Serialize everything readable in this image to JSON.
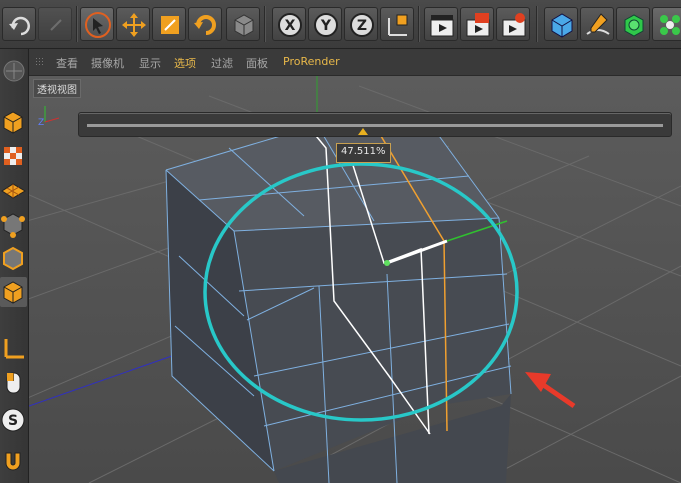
{
  "viewport_menu": {
    "view": "查看",
    "camera": "摄像机",
    "display": "显示",
    "options": "选项",
    "filter": "过滤",
    "panel": "面板",
    "prorender": "ProRender"
  },
  "viewport": {
    "title": "透视视图",
    "loop_percent": "47.511%",
    "loop_fraction": 0.47511
  },
  "toolbar": {
    "icons": [
      "undo-icon",
      "redo-icon",
      "select-icon",
      "move-icon",
      "scale-icon",
      "rotate-icon",
      "object-icon",
      "x-axis-icon",
      "y-axis-icon",
      "z-axis-icon",
      "coordinate-system-icon",
      "render-view-icon",
      "render-picture-viewer-icon",
      "render-settings-icon",
      "cube-primitive-icon",
      "pen-spline-icon",
      "subdivision-icon",
      "cloner-icon"
    ]
  },
  "left_toolbar": {
    "icons": [
      "make-editable-icon",
      "texture-mode-icon",
      "workplane-icon",
      "points-mode-icon",
      "edges-mode-icon",
      "polygons-mode-icon",
      "axis-mode-icon",
      "tweak-mode-icon",
      "snap-icon",
      "magnet-icon"
    ]
  },
  "colors": {
    "accent": "#e8b84a",
    "circle": "#28c8c8",
    "arrow": "#e83a2a",
    "mesh_edge": "#7fb0e0",
    "loop_cut": "#f0a030"
  }
}
